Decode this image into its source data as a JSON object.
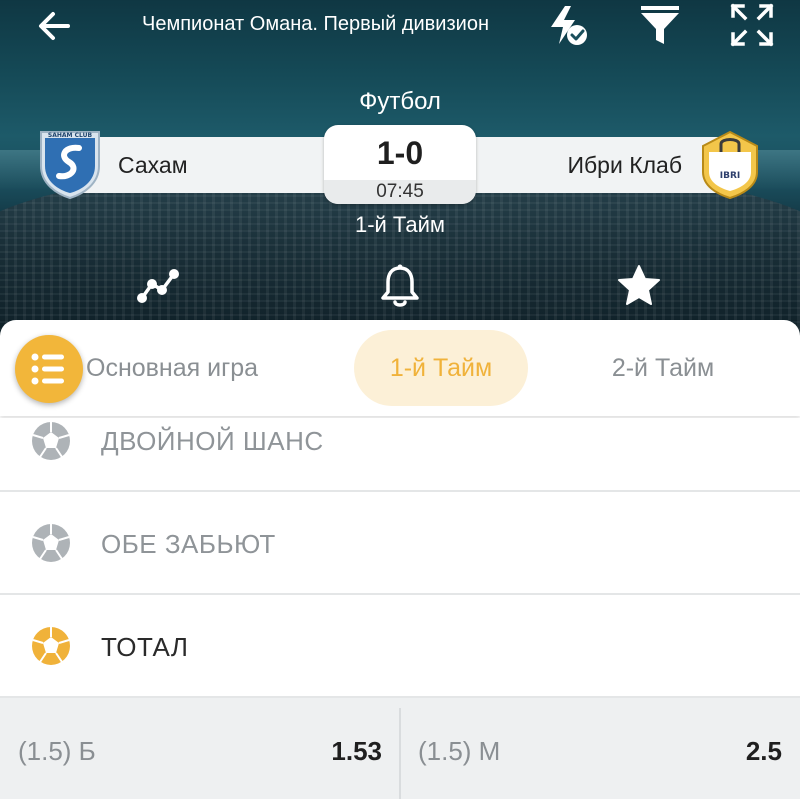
{
  "header": {
    "title": "Чемпионат Омана. Первый дивизион",
    "sport": "Футбол",
    "period_label": "1-й Тайм"
  },
  "match": {
    "home_team": "Сахам",
    "away_team": "Ибри Клаб",
    "score": "1-0",
    "time": "07:45"
  },
  "tabs": [
    {
      "label": "Основная игра"
    },
    {
      "label": "1-й Тайм"
    },
    {
      "label": "2-й Тайм"
    }
  ],
  "markets": [
    {
      "label": "ДВОЙНОЙ ШАНС"
    },
    {
      "label": "ОБЕ ЗАБЬЮТ"
    },
    {
      "label": "ТОТАЛ"
    }
  ],
  "odds": [
    {
      "label": "(1.5) Б",
      "value": "1.53"
    },
    {
      "label": "(1.5) М",
      "value": "2.5"
    }
  ],
  "logos": {
    "home_text": "SAHAM CLUB",
    "away_text": "IBRI"
  },
  "colors": {
    "accent": "#f0b23a",
    "accent_bg": "#fcf0d7",
    "header_bg": "#154a57"
  }
}
